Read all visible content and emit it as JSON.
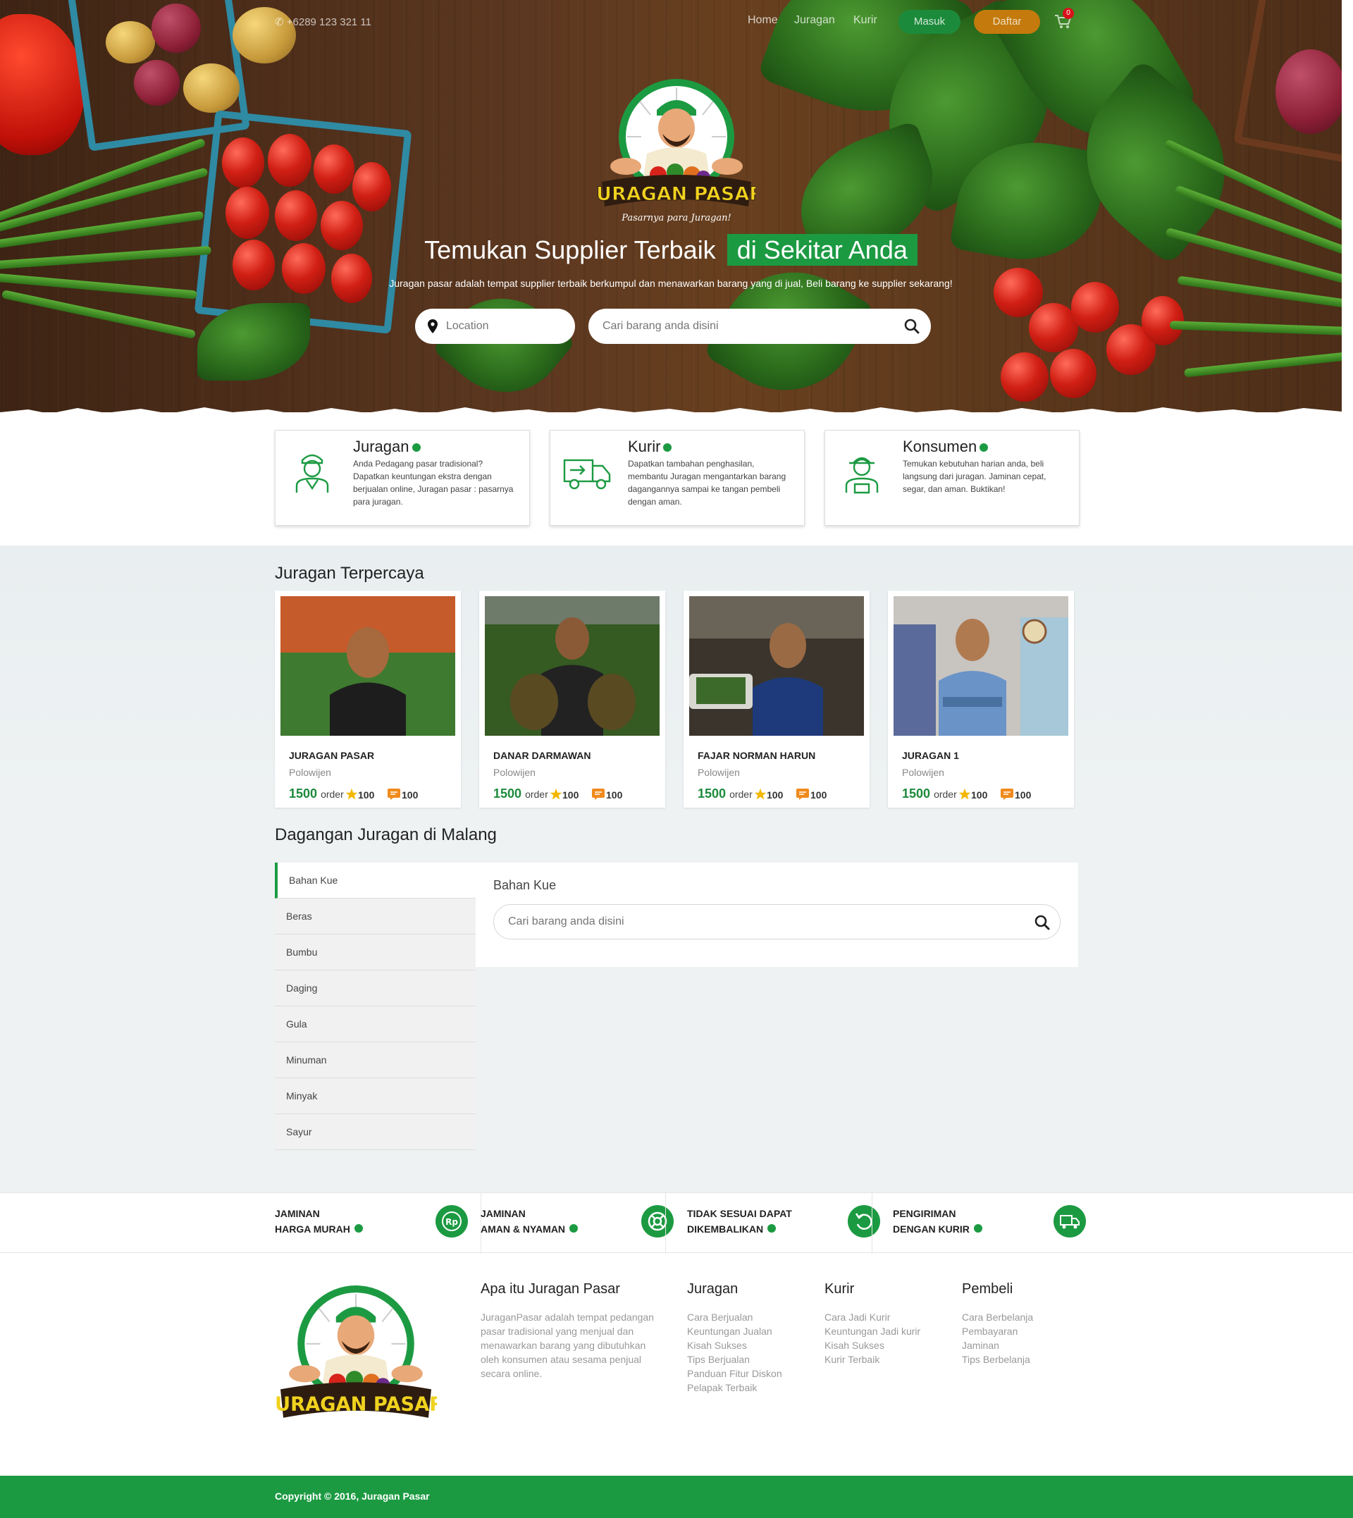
{
  "header": {
    "phone": "+6289 123 321 11",
    "nav": [
      "Home",
      "Juragan",
      "Kurir"
    ],
    "login_label": "Masuk",
    "register_label": "Daftar",
    "cart_count": "0"
  },
  "hero": {
    "logo_text": "JURAGAN PASAR",
    "logo_tagline": "Pasarnya para Juragan!",
    "title_main": "Temukan Supplier Terbaik",
    "title_highlight": "di Sekitar Anda",
    "subtitle": "Juragan pasar adalah tempat supplier terbaik berkumpul dan menawarkan barang yang di jual, Beli barang ke supplier sekarang!",
    "location_placeholder": "Location",
    "search_placeholder": "Cari barang anda disini"
  },
  "roles": [
    {
      "title": "Juragan",
      "icon": "seller-icon",
      "desc": "Anda Pedagang pasar tradisional? Dapatkan keuntungan ekstra dengan berjualan online, Juragan pasar : pasarnya para juragan."
    },
    {
      "title": "Kurir",
      "icon": "delivery-truck-icon",
      "desc": "Dapatkan tambahan penghasilan, membantu Juragan mengantarkan barang dagangannya sampai ke tangan pembeli dengan aman."
    },
    {
      "title": "Konsumen",
      "icon": "customer-icon",
      "desc": "Temukan kebutuhan harian anda, beli langsung dari juragan. Jaminan cepat, segar, dan aman. Buktikan!"
    }
  ],
  "trusted": {
    "title": "Juragan Terpercaya",
    "items": [
      {
        "name": "JURAGAN PASAR",
        "location": "Polowijen",
        "orders": "1500",
        "order_label": "order",
        "rating": "100",
        "reviews": "100"
      },
      {
        "name": "DANAR DARMAWAN",
        "location": "Polowijen",
        "orders": "1500",
        "order_label": "order",
        "rating": "100",
        "reviews": "100"
      },
      {
        "name": "FAJAR NORMAN HARUN",
        "location": "Polowijen",
        "orders": "1500",
        "order_label": "order",
        "rating": "100",
        "reviews": "100"
      },
      {
        "name": "JURAGAN 1",
        "location": "Polowijen",
        "orders": "1500",
        "order_label": "order",
        "rating": "100",
        "reviews": "100"
      }
    ]
  },
  "goods": {
    "title": "Dagangan Juragan di Malang",
    "categories": [
      "Bahan Kue",
      "Beras",
      "Bumbu",
      "Daging",
      "Gula",
      "Minuman",
      "Minyak",
      "Sayur"
    ],
    "active_category": "Bahan Kue",
    "search_placeholder": "Cari barang anda disini"
  },
  "guarantees": [
    {
      "line1": "JAMINAN",
      "line2": "HARGA MURAH",
      "icon": "rupiah-icon"
    },
    {
      "line1": "JAMINAN",
      "line2": "AMAN & NYAMAN",
      "icon": "lifebuoy-icon"
    },
    {
      "line1": "TIDAK SESUAI DAPAT",
      "line2": "DIKEMBALIKAN",
      "icon": "undo-icon"
    },
    {
      "line1": "PENGIRIMAN",
      "line2": "DENGAN KURIR",
      "icon": "truck-icon"
    }
  ],
  "footer": {
    "about_title": "Apa itu Juragan Pasar",
    "about_text": "JuraganPasar adalah tempat pedangan pasar tradisional yang menjual dan menawarkan barang yang dibutuhkan oleh konsumen atau sesama penjual secara online.",
    "columns": [
      {
        "title": "Juragan",
        "links": [
          "Cara Berjualan",
          "Keuntungan Jualan",
          "Kisah Sukses",
          "Tips Berjualan",
          "Panduan Fitur Diskon",
          "Pelapak Terbaik"
        ]
      },
      {
        "title": "Kurir",
        "links": [
          "Cara Jadi Kurir",
          "Keuntungan Jadi kurir",
          "Kisah Sukses",
          "Kurir Terbaik"
        ]
      },
      {
        "title": "Pembeli",
        "links": [
          "Cara Berbelanja",
          "Pembayaran",
          "Jaminan",
          "Tips Berbelanja"
        ]
      }
    ],
    "copyright": "Copyright © 2016, Juragan Pasar"
  },
  "colors": {
    "brand_green": "#1c9a42",
    "daftar_orange": "#c47a0c",
    "badge_red": "#d8131b"
  }
}
